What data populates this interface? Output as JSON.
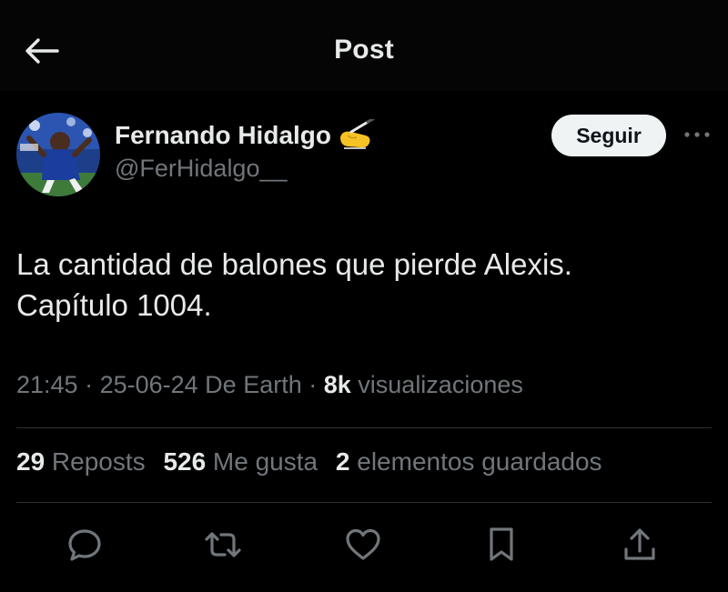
{
  "header": {
    "title": "Post"
  },
  "author": {
    "name": "Fernando Hidalgo",
    "name_emoji": "writing-hand-emoji",
    "handle": "@FerHidalgo__",
    "follow_label": "Seguir"
  },
  "tweet": {
    "lines": [
      "La cantidad de balones que pierde Alexis.",
      "Capítulo 1004."
    ]
  },
  "meta": {
    "time": "21:45",
    "sep1": " · ",
    "date": "25-06-24",
    "source": " De Earth",
    "sep2": " · ",
    "views_count": "8k",
    "views_label": " visualizaciones"
  },
  "stats": {
    "reposts_count": "29",
    "reposts_label": " Reposts",
    "likes_count": "526",
    "likes_label": " Me gusta",
    "saves_count": "2",
    "saves_label": " elementos guardados"
  },
  "icons": {
    "back": "arrow-left-icon",
    "more": "more-dots-icon",
    "reply": "reply-icon",
    "repost": "repost-icon",
    "like": "heart-icon",
    "bookmark": "bookmark-icon",
    "share": "share-icon"
  },
  "colors": {
    "background": "#000000",
    "text_primary": "#e7e9ea",
    "text_secondary": "#71767b",
    "divider": "#2f3336",
    "follow_button_bg": "#eff3f4"
  }
}
